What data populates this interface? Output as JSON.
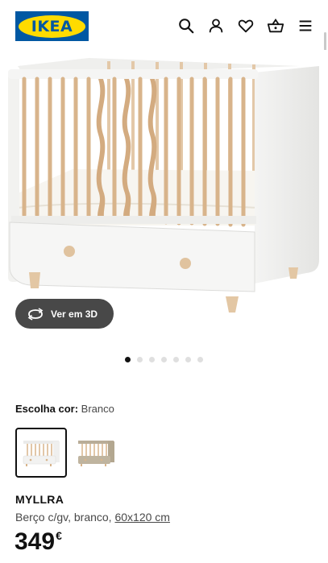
{
  "header": {
    "logo_text": "IKEA",
    "icons": [
      "search-icon",
      "user-icon",
      "heart-icon",
      "basket-icon",
      "menu-icon"
    ],
    "brand_blue": "#0058a3",
    "brand_yellow": "#ffdb00"
  },
  "gallery": {
    "view3d_label": "Ver em 3D",
    "dots_count": 7,
    "active_dot": 1
  },
  "product": {
    "color_key": "Escolha cor:",
    "color_value": "Branco",
    "variants": [
      "white-crib-swatch",
      "beige-crib-swatch"
    ],
    "selected_variant": 1,
    "name": "MYLLRA",
    "desc_main": "Berço c/gv, branco, ",
    "desc_size": "60x120 cm",
    "price_int": "349",
    "price_currency": "€"
  }
}
